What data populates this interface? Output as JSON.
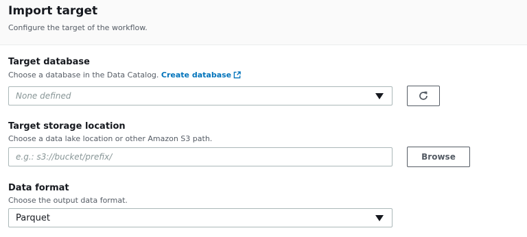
{
  "header": {
    "title": "Import target",
    "subtitle": "Configure the target of the workflow."
  },
  "target_database": {
    "label": "Target database",
    "description": "Choose a database in the Data Catalog.",
    "link_label": "Create database",
    "placeholder": "None defined",
    "refresh_icon": "refresh-icon"
  },
  "target_storage": {
    "label": "Target storage location",
    "description": "Choose a data lake location or other Amazon S3 path.",
    "placeholder": "e.g.: s3://bucket/prefix/",
    "browse_label": "Browse"
  },
  "data_format": {
    "label": "Data format",
    "description": "Choose the output data format.",
    "selected": "Parquet"
  },
  "colors": {
    "link": "#0073bb",
    "text": "#16191f",
    "muted": "#545b64",
    "border": "#aab7b8"
  }
}
